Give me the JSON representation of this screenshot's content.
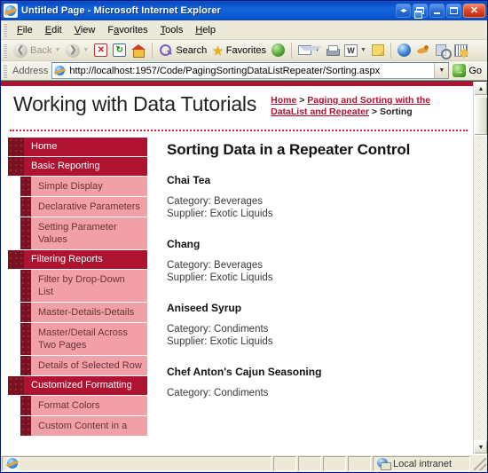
{
  "window": {
    "title": "Untitled Page - Microsoft Internet Explorer",
    "icon": "ie-document-icon",
    "buttons": {
      "restore_group": "◂▸",
      "restore_window": "restore",
      "minimize": "minimize",
      "maximize": "maximize",
      "close": "✕"
    }
  },
  "menubar": {
    "items": [
      {
        "label": "File",
        "accel": "F",
        "rest": "ile"
      },
      {
        "label": "Edit",
        "accel": "E",
        "rest": "dit"
      },
      {
        "label": "View",
        "accel": "V",
        "rest": "iew"
      },
      {
        "label": "Favorites",
        "accel": "a",
        "pre": "F",
        "rest": "vorites"
      },
      {
        "label": "Tools",
        "accel": "T",
        "rest": "ools"
      },
      {
        "label": "Help",
        "accel": "H",
        "rest": "elp"
      }
    ]
  },
  "toolbar": {
    "back_label": "Back",
    "forward_label": "",
    "search_label": "Search",
    "favorites_label": "Favorites",
    "icons": [
      "back-arrow-icon",
      "forward-arrow-icon",
      "stop-icon",
      "refresh-icon",
      "home-icon",
      "search-icon",
      "favorites-star-icon",
      "history-icon",
      "mail-icon",
      "print-icon",
      "edit-icon",
      "notes-icon",
      "msn-icon",
      "messenger-icon",
      "research-icon",
      "spreadsheet-icon"
    ],
    "edit_glyph": "W",
    "dropdown_caret": "▼"
  },
  "address": {
    "label": "Address",
    "url": "http://localhost:1957/Code/PagingSortingDataListRepeater/Sorting.aspx",
    "placeholder": "",
    "go_label": "Go",
    "go_glyph": "→",
    "dropdown_caret": "▼"
  },
  "page": {
    "site_title": "Working with Data Tutorials",
    "breadcrumb": {
      "home": "Home",
      "sep1": " > ",
      "section": "Paging and Sorting with the DataList and Repeater",
      "sep2": " > ",
      "current": "Sorting"
    },
    "accent_color": "#b01232",
    "nav_item_color": "#f2a0a8",
    "sidebar": [
      {
        "type": "section",
        "label": "Home"
      },
      {
        "type": "section",
        "label": "Basic Reporting"
      },
      {
        "type": "item",
        "label": "Simple Display"
      },
      {
        "type": "item",
        "label": "Declarative Parameters"
      },
      {
        "type": "item",
        "label": "Setting Parameter Values"
      },
      {
        "type": "section",
        "label": "Filtering Reports"
      },
      {
        "type": "item",
        "label": "Filter by Drop-Down List"
      },
      {
        "type": "item",
        "label": "Master-Details-Details"
      },
      {
        "type": "item",
        "label": "Master/Detail Across Two Pages"
      },
      {
        "type": "item",
        "label": "Details of Selected Row"
      },
      {
        "type": "section",
        "label": "Customized Formatting"
      },
      {
        "type": "item",
        "label": "Format Colors"
      },
      {
        "type": "item",
        "label": "Custom Content in a"
      }
    ],
    "heading": "Sorting Data in a Repeater Control",
    "products": [
      {
        "name": "Chai Tea",
        "category": "Category: Beverages",
        "supplier": "Supplier: Exotic Liquids"
      },
      {
        "name": "Chang",
        "category": "Category: Beverages",
        "supplier": "Supplier: Exotic Liquids"
      },
      {
        "name": "Aniseed Syrup",
        "category": "Category: Condiments",
        "supplier": "Supplier: Exotic Liquids"
      },
      {
        "name": "Chef Anton's Cajun Seasoning",
        "category": "Category: Condiments",
        "supplier": ""
      }
    ]
  },
  "statusbar": {
    "message": "",
    "zone": "Local intranet",
    "zone_icon": "internet-zone-icon"
  }
}
